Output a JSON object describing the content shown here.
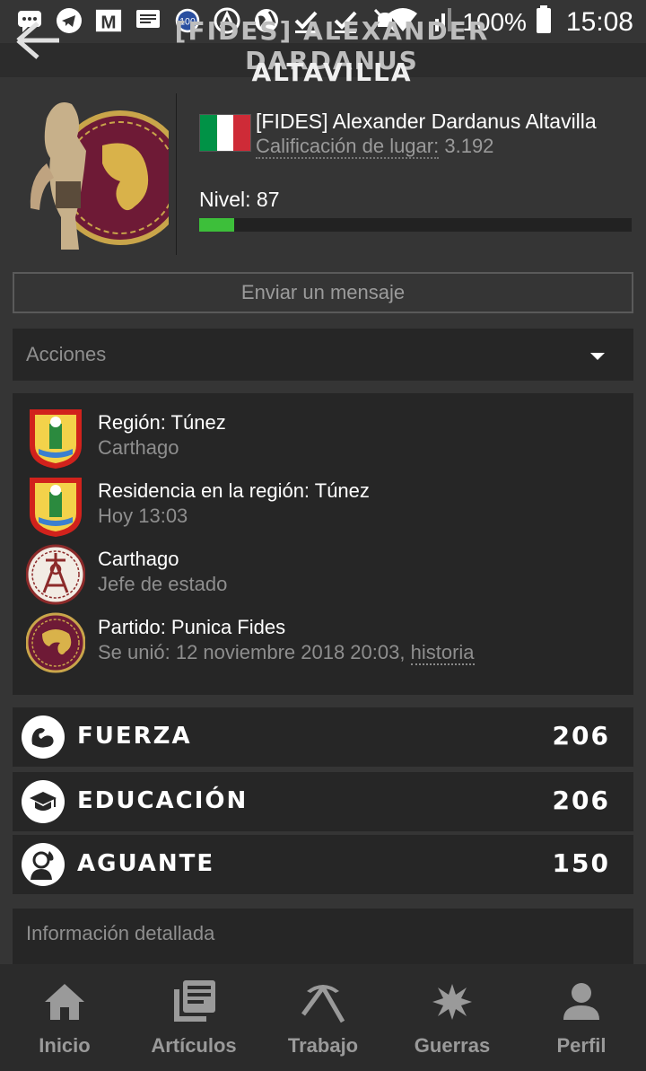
{
  "status_bar": {
    "icons": [
      "chat-icon",
      "telegram-icon",
      "gmail-icon",
      "message-icon",
      "badge-100-icon",
      "vpn-icon",
      "globe-icon",
      "check-icon",
      "check-icon",
      "mute-icon",
      "wifi-icon",
      "signal-icon"
    ],
    "badge_text": "100",
    "gmail_text": "M",
    "battery": "100%",
    "time": "15:08"
  },
  "header": {
    "title_line1": "[FIDES] Alexander Dardanus",
    "title_line2": "Altavilla"
  },
  "profile": {
    "name": "[FIDES] Alexander Dardanus Altavilla",
    "rank_label": "Calificación de lugar:",
    "rank_value": "3.192",
    "level": "Nivel: 87",
    "xp_fraction": 0.08,
    "flag_colors": [
      "#009246",
      "#ffffff",
      "#ce2b37"
    ]
  },
  "actions": {
    "send_message": "Enviar un mensaje",
    "dropdown": "Acciones"
  },
  "info": {
    "region_title": "Región: Túnez",
    "region_sub": "Carthago",
    "residence_title": "Residencia en la región: Túnez",
    "residence_sub": "Hoy 13:03",
    "state_title": "Carthago",
    "state_sub": "Jefe de estado",
    "party_title": "Partido: Punica Fides",
    "party_sub": "Se unió: 12 noviembre 2018 20:03,",
    "party_link": "historia"
  },
  "stats": [
    {
      "label": "Fuerza",
      "value": "206",
      "icon": "strength-arm-icon"
    },
    {
      "label": "Educación",
      "value": "206",
      "icon": "graduation-cap-icon"
    },
    {
      "label": "Aguante",
      "value": "150",
      "icon": "endurance-person-icon"
    }
  ],
  "details": "Información detallada",
  "nav": [
    {
      "label": "Inicio",
      "icon": "home-icon"
    },
    {
      "label": "Artículos",
      "icon": "articles-icon"
    },
    {
      "label": "Trabajo",
      "icon": "pickaxe-icon"
    },
    {
      "label": "Guerras",
      "icon": "explosion-icon"
    },
    {
      "label": "Perfil",
      "icon": "person-icon"
    }
  ],
  "colors": {
    "background": "#353535",
    "panel": "#262626",
    "xp_green": "#3dbf3a",
    "muted_text": "#8f8f8f"
  }
}
